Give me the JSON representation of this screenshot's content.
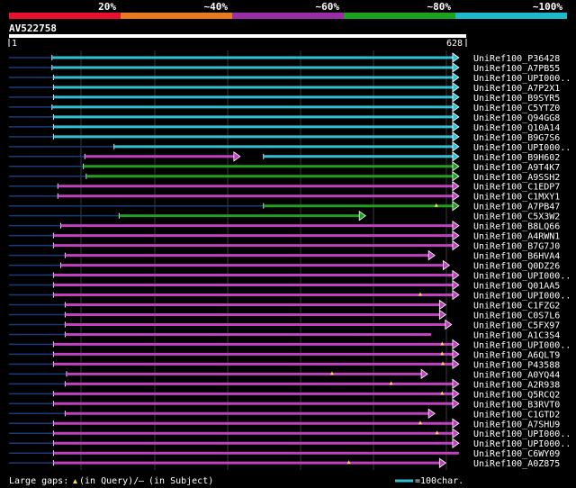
{
  "query": {
    "name": "AV522758",
    "start": "1",
    "end": "628",
    "length": 628
  },
  "identity_scale": {
    "segments": [
      {
        "color": "#e8102e",
        "label": "20%"
      },
      {
        "color": "#e87a1e",
        "label": "~40%"
      },
      {
        "color": "#9a2ea6",
        "label": "~60%"
      },
      {
        "color": "#1ba41b",
        "label": "~80%"
      },
      {
        "color": "#1cbac8",
        "label": "~100%"
      }
    ]
  },
  "colors": {
    "magenta": "#c040c0",
    "cyan": "#30c0d0",
    "green": "#20a020",
    "unaligned": "#1a3a7a",
    "gap": "#f4e040"
  },
  "legend": {
    "gaps_label": "Large gaps:",
    "in_query": "(in Query)/",
    "dash": "–",
    "in_subject": "(in Subject)",
    "scale_label": "=100char."
  },
  "chart_data": {
    "type": "alignment",
    "x_range": [
      1,
      628
    ],
    "hits": [
      {
        "name": "UniRef100_P36428",
        "color": "cyan",
        "start": 60,
        "end": 618,
        "arrow": true
      },
      {
        "name": "UniRef100_A7PB55",
        "color": "cyan",
        "start": 60,
        "end": 618,
        "arrow": true
      },
      {
        "name": "UniRef100_UPI000..",
        "color": "cyan",
        "start": 62,
        "end": 618,
        "arrow": true
      },
      {
        "name": "UniRef100_A7P2X1",
        "color": "cyan",
        "start": 62,
        "end": 618,
        "arrow": true
      },
      {
        "name": "UniRef100_B9SYR5",
        "color": "cyan",
        "start": 62,
        "end": 618,
        "arrow": true
      },
      {
        "name": "UniRef100_C5YTZ0",
        "color": "cyan",
        "start": 60,
        "end": 618,
        "arrow": true
      },
      {
        "name": "UniRef100_Q94GG8",
        "color": "cyan",
        "start": 62,
        "end": 618,
        "arrow": true
      },
      {
        "name": "UniRef100_Q10A14",
        "color": "cyan",
        "start": 62,
        "end": 618,
        "arrow": true
      },
      {
        "name": "UniRef100_B9G7S6",
        "color": "cyan",
        "start": 62,
        "end": 618,
        "arrow": true
      },
      {
        "name": "UniRef100_UPI000..",
        "color": "cyan",
        "start": 145,
        "end": 618,
        "arrow": true
      },
      {
        "name": "UniRef100_B9H602",
        "color": "magenta",
        "start": 105,
        "end": 318,
        "arrow": true,
        "color2": "cyan",
        "start2": 350,
        "end2": 618
      },
      {
        "name": "UniRef100_A9T4K7",
        "color": "green",
        "start": 103,
        "end": 618,
        "arrow": true
      },
      {
        "name": "UniRef100_A9SSH2",
        "color": "green",
        "start": 107,
        "end": 618,
        "arrow": true
      },
      {
        "name": "UniRef100_C1EDP7",
        "color": "magenta",
        "start": 68,
        "end": 618,
        "arrow": true
      },
      {
        "name": "UniRef100_C1MXY1",
        "color": "magenta",
        "start": 68,
        "end": 618,
        "arrow": true
      },
      {
        "name": "UniRef100_A7PB47",
        "color": "green",
        "start": 350,
        "end": 618,
        "arrow": true,
        "gaps": [
          587
        ]
      },
      {
        "name": "UniRef100_C5X3W2",
        "color": "green",
        "start": 152,
        "end": 490,
        "arrow": true
      },
      {
        "name": "UniRef100_B8LQ66",
        "color": "magenta",
        "start": 72,
        "end": 618,
        "arrow": true
      },
      {
        "name": "UniRef100_A4RWN1",
        "color": "magenta",
        "start": 62,
        "end": 618,
        "arrow": true
      },
      {
        "name": "UniRef100_B7G7J0",
        "color": "magenta",
        "start": 62,
        "end": 618,
        "arrow": true
      },
      {
        "name": "UniRef100_B6HVA4",
        "color": "magenta",
        "start": 78,
        "end": 585,
        "arrow": true
      },
      {
        "name": "UniRef100_Q0DZ26",
        "color": "magenta",
        "start": 72,
        "end": 605,
        "arrow": true
      },
      {
        "name": "UniRef100_UPI000..",
        "color": "magenta",
        "start": 62,
        "end": 618,
        "arrow": true
      },
      {
        "name": "UniRef100_Q01AA5",
        "color": "magenta",
        "start": 62,
        "end": 618,
        "arrow": true
      },
      {
        "name": "UniRef100_UPI000..",
        "color": "magenta",
        "start": 62,
        "end": 618,
        "arrow": true,
        "gaps": [
          565
        ]
      },
      {
        "name": "UniRef100_C1FZG2",
        "color": "magenta",
        "start": 78,
        "end": 600,
        "arrow": true
      },
      {
        "name": "UniRef100_C0S7L6",
        "color": "magenta",
        "start": 78,
        "end": 600,
        "arrow": true
      },
      {
        "name": "UniRef100_C5FX97",
        "color": "magenta",
        "start": 78,
        "end": 608,
        "arrow": true
      },
      {
        "name": "UniRef100_A1C3S4",
        "color": "magenta",
        "start": 78,
        "end": 580,
        "arrow": false
      },
      {
        "name": "UniRef100_UPI000..",
        "color": "magenta",
        "start": 62,
        "end": 618,
        "arrow": true,
        "gaps": [
          595
        ]
      },
      {
        "name": "UniRef100_A6QLT9",
        "color": "magenta",
        "start": 62,
        "end": 618,
        "arrow": true,
        "gaps": [
          595
        ]
      },
      {
        "name": "UniRef100_P43588",
        "color": "magenta",
        "start": 62,
        "end": 618,
        "arrow": true,
        "gaps": [
          596
        ]
      },
      {
        "name": "UniRef100_A0YQ44",
        "color": "magenta",
        "start": 80,
        "end": 575,
        "arrow": true,
        "gaps": [
          444
        ]
      },
      {
        "name": "UniRef100_A2R938",
        "color": "magenta",
        "start": 78,
        "end": 618,
        "arrow": true,
        "gaps": [
          525
        ]
      },
      {
        "name": "UniRef100_Q5RCQ2",
        "color": "magenta",
        "start": 62,
        "end": 618,
        "arrow": true,
        "gaps": [
          595
        ]
      },
      {
        "name": "UniRef100_B3RVT0",
        "color": "magenta",
        "start": 62,
        "end": 618,
        "arrow": true
      },
      {
        "name": "UniRef100_C1GTD2",
        "color": "magenta",
        "start": 78,
        "end": 585,
        "arrow": true
      },
      {
        "name": "UniRef100_A7SHU9",
        "color": "magenta",
        "start": 62,
        "end": 618,
        "arrow": true,
        "gaps": [
          565
        ]
      },
      {
        "name": "UniRef100_UPI000..",
        "color": "magenta",
        "start": 62,
        "end": 618,
        "arrow": true,
        "gaps": [
          588
        ]
      },
      {
        "name": "UniRef100_UPI000..",
        "color": "magenta",
        "start": 62,
        "end": 618,
        "arrow": true
      },
      {
        "name": "UniRef100_C6WY09",
        "color": "magenta",
        "start": 62,
        "end": 618,
        "arrow": false
      },
      {
        "name": "UniRef100_A0Z875",
        "color": "magenta",
        "start": 62,
        "end": 600,
        "arrow": true,
        "gaps": [
          467
        ]
      }
    ]
  }
}
